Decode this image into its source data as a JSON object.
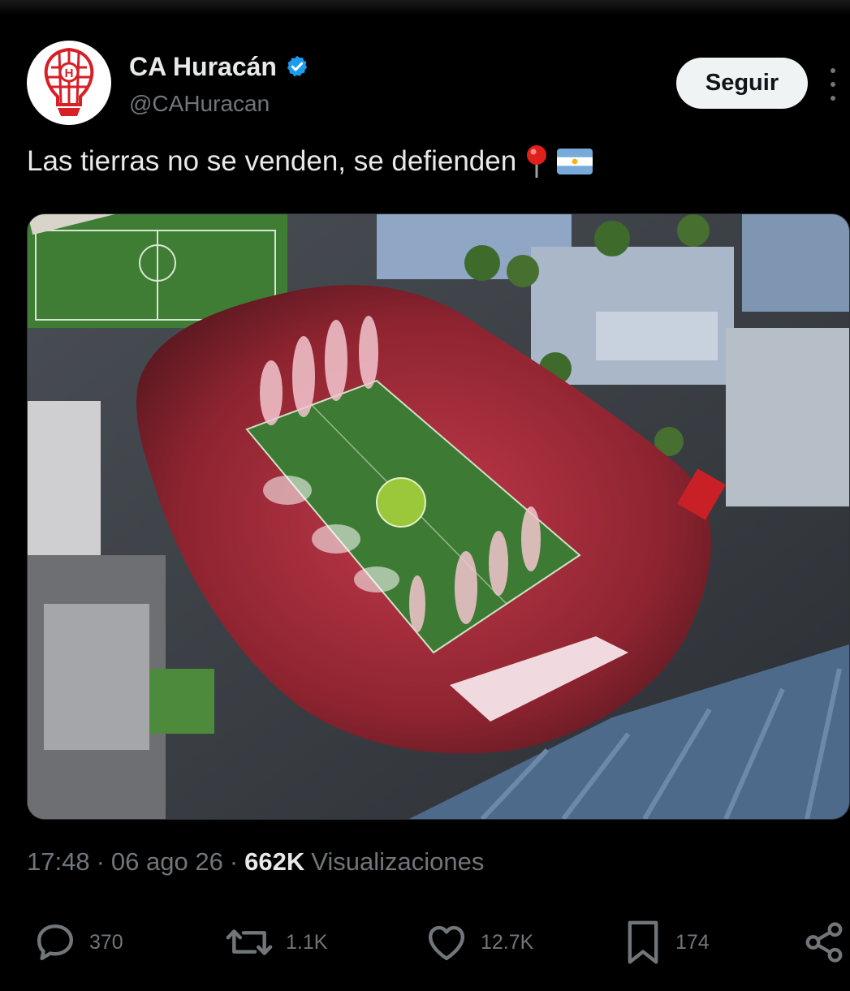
{
  "tweet": {
    "author": {
      "display_name": "CA Huracán",
      "handle": "@CAHuracan",
      "verified_icon": "verified-badge-icon",
      "avatar_icon": "huracan-crest-logo"
    },
    "follow_label": "Seguir",
    "text": "Las tierras no se venden, se defienden",
    "text_emojis": [
      "round-pushpin-emoji",
      "argentina-flag-emoji"
    ],
    "media": {
      "kind": "photo",
      "description_icon": "stadium-aerial-photo"
    },
    "meta": {
      "time": "17:48",
      "sep1": "·",
      "date": "06 ago 26",
      "sep2": "·",
      "views_count": "662K",
      "views_label": "Visualizaciones"
    },
    "actions": {
      "replies": "370",
      "reposts": "1.1K",
      "likes": "12.7K",
      "bookmarks": "174"
    }
  },
  "colors": {
    "background": "#000000",
    "text_primary": "#e7e9ea",
    "text_secondary": "#71767b",
    "verified_blue": "#1d9bf0",
    "follow_bg": "#eff3f4",
    "club_red": "#d71f26"
  }
}
